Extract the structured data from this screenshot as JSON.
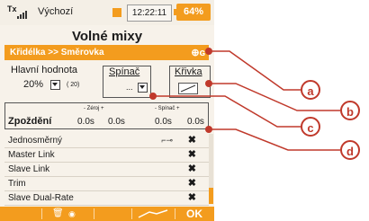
{
  "status": {
    "tx": "Tx",
    "tx_sub": "mold",
    "model_name": "Výchozí",
    "time": "12:22:11",
    "battery": "64%"
  },
  "title": "Volné mixy",
  "mix": {
    "label": "Křidélka >> Směrovka"
  },
  "main_value": {
    "label": "Hlavní hodnota",
    "value": "20%",
    "sub": "( 20)"
  },
  "switch": {
    "label": "Spínač",
    "value": "..."
  },
  "curve": {
    "label": "Křivka"
  },
  "delay": {
    "label": "Zpoždění",
    "zero_head": "- Zéroj +",
    "switch_head": "- Spínač +",
    "values": [
      "0.0s",
      "0.0s",
      "0.0s",
      "0.0s"
    ]
  },
  "options": [
    {
      "label": "Jednosměrný",
      "mark": "✖",
      "has_switch": true
    },
    {
      "label": "Master Link",
      "mark": "✖",
      "has_switch": false
    },
    {
      "label": "Slave Link",
      "mark": "✖",
      "has_switch": false
    },
    {
      "label": "Trim",
      "mark": "✖",
      "has_switch": false
    },
    {
      "label": "Slave Dual-Rate",
      "mark": "✖",
      "has_switch": false
    }
  ],
  "bottom": {
    "ok": "OK"
  },
  "callouts": {
    "a": "a",
    "b": "b",
    "c": "c",
    "d": "d"
  },
  "colors": {
    "accent": "#f39c1e",
    "callout": "#c0392b"
  }
}
